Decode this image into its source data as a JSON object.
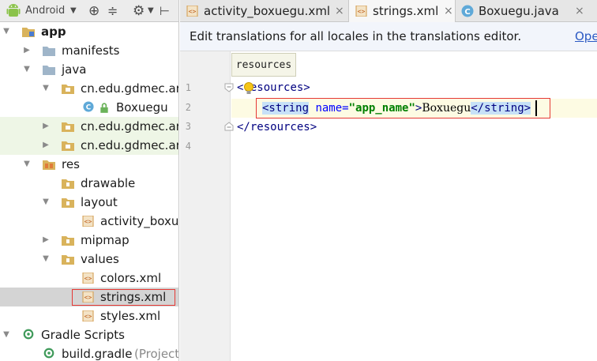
{
  "project_panel": {
    "view_selector": "Android",
    "tree": [
      {
        "label": "app",
        "type": "module",
        "expanded": true,
        "bold": true
      },
      {
        "label": "manifests",
        "type": "folder",
        "expanded": false
      },
      {
        "label": "java",
        "type": "folder",
        "expanded": true
      },
      {
        "label": "cn.edu.gdmec.an",
        "type": "package",
        "expanded": true
      },
      {
        "label": "Boxuegu",
        "type": "class"
      },
      {
        "label": "cn.edu.gdmec.an",
        "type": "package",
        "expanded": false
      },
      {
        "label": "cn.edu.gdmec.an",
        "type": "package",
        "expanded": false
      },
      {
        "label": "res",
        "type": "folder",
        "expanded": true
      },
      {
        "label": "drawable",
        "type": "folder",
        "expanded": false
      },
      {
        "label": "layout",
        "type": "folder",
        "expanded": true
      },
      {
        "label": "activity_boxue",
        "type": "xml"
      },
      {
        "label": "mipmap",
        "type": "folder",
        "expanded": false
      },
      {
        "label": "values",
        "type": "folder",
        "expanded": true
      },
      {
        "label": "colors.xml",
        "type": "xml"
      },
      {
        "label": "strings.xml",
        "type": "xml",
        "selected": true
      },
      {
        "label": "styles.xml",
        "type": "xml"
      },
      {
        "label": "Gradle Scripts",
        "type": "gradle",
        "expanded": true
      },
      {
        "label": "build.gradle",
        "suffix": "(Project",
        "type": "gradle-file"
      }
    ]
  },
  "tabs": [
    {
      "label": "activity_boxuegu.xml",
      "close": "×"
    },
    {
      "label": "strings.xml",
      "close": "×",
      "active": true
    },
    {
      "label": "Boxuegu.java",
      "close": "×"
    }
  ],
  "banner": {
    "text": "Edit translations for all locales in the translations editor.",
    "link": "Ope"
  },
  "editor": {
    "breadcrumb_popup": "resources",
    "line_numbers": [
      "1",
      "2",
      "3",
      "4"
    ],
    "lines": {
      "l1_open": "<",
      "l1_tag": "resources",
      "l1_close": ">",
      "l2_open_tag": "<string",
      "l2_attr": " name=",
      "l2_val": "\"app_name\"",
      "l2_gt": ">",
      "l2_text": "Boxuegu",
      "l2_close_tag": "</string>",
      "l3_close": "</resources>"
    }
  },
  "colors": {
    "accent_red": "#e53935",
    "selection_blue": "#c7e1f7",
    "android_green": "#8bc34a"
  }
}
